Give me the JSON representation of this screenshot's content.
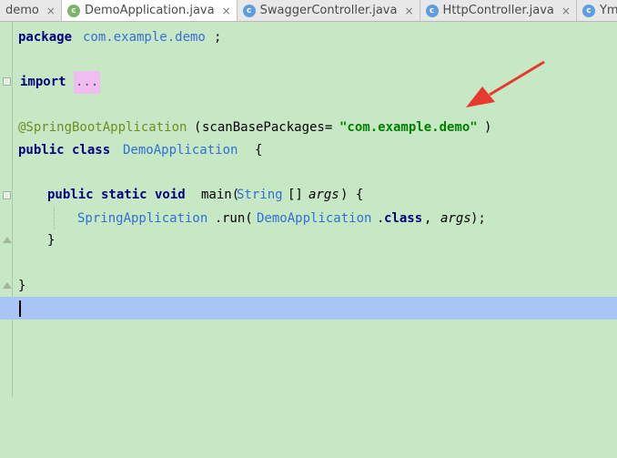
{
  "tabs": [
    {
      "label": "demo",
      "icon": "",
      "active": false
    },
    {
      "label": "DemoApplication.java",
      "icon": "spring-boot-class-icon",
      "active": true
    },
    {
      "label": "SwaggerController.java",
      "icon": "class-icon",
      "active": false
    },
    {
      "label": "HttpController.java",
      "icon": "class-icon",
      "active": false
    },
    {
      "label": "YmlController",
      "icon": "class-icon",
      "active": false
    }
  ],
  "tab_close_glyph": "×",
  "class_icon_letter": "c",
  "code": {
    "l1": {
      "kw": "package",
      "pkg": "com.example.demo",
      "end": ";"
    },
    "l2": {
      "kw": "import",
      "folded": "..."
    },
    "l3": {
      "ann": "@SpringBootApplication",
      "open": "(",
      "arg": "scanBasePackages=",
      "str": "\"com.example.demo\"",
      "close": ")"
    },
    "l4": {
      "kw": "public class",
      "cls": "DemoApplication",
      "brace": "{"
    },
    "l5": {
      "kw": "public static void",
      "fn": "main(",
      "type": "String",
      "arr": "[] ",
      "prm": "args",
      "close": ") {"
    },
    "l6": {
      "cls": "SpringApplication",
      "dot": ".",
      "fn": "run(",
      "arg_cls": "DemoApplication",
      "dotclass": ".",
      "kw": "class",
      "comma": ", ",
      "prm": "args",
      "end": ");"
    },
    "l7": {
      "brace": "}"
    },
    "l8": {
      "brace": "}"
    }
  },
  "colors": {
    "editor_bg": "#c7e8c5",
    "caret_line": "#a8c5f5",
    "arrow": "#e8392e",
    "keyword": "#000080",
    "string": "#008000"
  }
}
